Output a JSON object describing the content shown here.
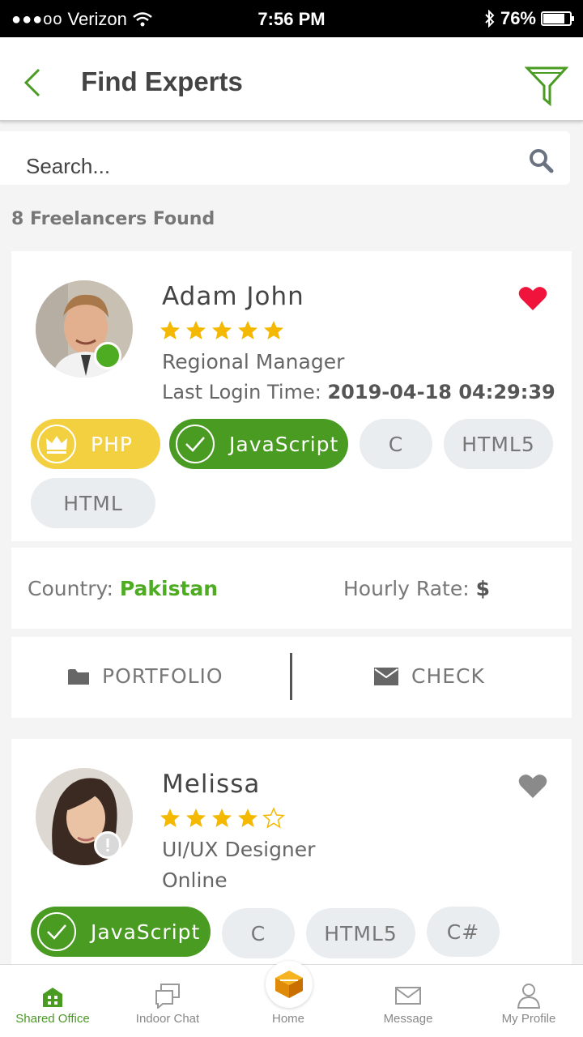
{
  "status_bar": {
    "signal": "●●●oo",
    "carrier": "Verizon",
    "time": "7:56 PM",
    "battery": "76%",
    "battery_level": 0.76
  },
  "header": {
    "title": "Find Experts"
  },
  "search": {
    "placeholder": "Search..."
  },
  "results": {
    "count_text": "8 Freelancers Found"
  },
  "experts": [
    {
      "name": "Adam John",
      "rating": 5,
      "role": "Regional Manager",
      "last_login_label": "Last Login Time:",
      "last_login_value": "2019-04-18 04:29:39",
      "favorite": true,
      "online": true,
      "skills": [
        {
          "label": "PHP",
          "style": "premium"
        },
        {
          "label": "JavaScript",
          "style": "verified"
        },
        {
          "label": "C",
          "style": "plain"
        },
        {
          "label": "HTML5",
          "style": "plain"
        },
        {
          "label": "HTML",
          "style": "plain"
        }
      ],
      "country_label": "Country:",
      "country": "Pakistan",
      "rate_label": "Hourly Rate:",
      "rate": "$",
      "actions": {
        "portfolio": "PORTFOLIO",
        "check": "CHECK"
      }
    },
    {
      "name": "Melissa",
      "rating": 4,
      "role": "UI/UX Designer",
      "status_text": "Online",
      "favorite": false,
      "online": false,
      "skills": [
        {
          "label": "JavaScript",
          "style": "verified"
        },
        {
          "label": "C",
          "style": "plain"
        },
        {
          "label": "HTML5",
          "style": "plain"
        },
        {
          "label": "C#",
          "style": "plain"
        }
      ]
    }
  ],
  "tabs": [
    {
      "label": "Shared Office",
      "icon": "building-icon",
      "active": true
    },
    {
      "label": "Indoor Chat",
      "icon": "chat-icon",
      "active": false
    },
    {
      "label": "Home",
      "icon": "home-cube-icon",
      "active": false
    },
    {
      "label": "Message",
      "icon": "envelope-icon",
      "active": false
    },
    {
      "label": "My Profile",
      "icon": "user-icon",
      "active": false
    }
  ],
  "colors": {
    "accent_green": "#4a9b22",
    "premium_gold": "#f2d040",
    "favorite_red": "#f0143c",
    "star": "#f5b800"
  }
}
